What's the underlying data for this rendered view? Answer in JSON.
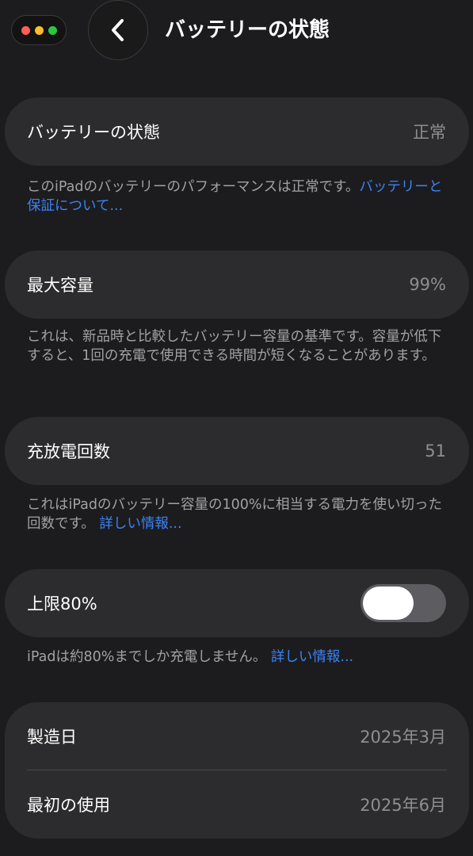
{
  "header": {
    "title": "バッテリーの状態",
    "window_dots": [
      "#ff5f57",
      "#febc2e",
      "#28c840"
    ]
  },
  "battery_health": {
    "label": "バッテリーの状態",
    "value": "正常",
    "footnote_text": "このiPadのバッテリーのパフォーマンスは正常です。",
    "footnote_link": "バッテリーと保証について..."
  },
  "max_capacity": {
    "label": "最大容量",
    "value": "99%",
    "footnote_text": "これは、新品時と比較したバッテリー容量の基準です。容量が低下すると、1回の充電で使用できる時間が短くなることがあります。"
  },
  "cycle_count": {
    "label": "充放電回数",
    "value": "51",
    "footnote_text": "これはiPadのバッテリー容量の100%に相当する電力を使い切った回数です。",
    "footnote_link": "詳しい情報..."
  },
  "limit": {
    "label": "上限80%",
    "toggle_on": false,
    "footnote_text": "iPadは約80%までしか充電しません。",
    "footnote_link": "詳しい情報..."
  },
  "dates": {
    "manufacture_label": "製造日",
    "manufacture_value": "2025年3月",
    "first_use_label": "最初の使用",
    "first_use_value": "2025年6月"
  },
  "colors": {
    "background": "#1c1c1e",
    "card": "#2c2c2e",
    "link": "#3b82f6",
    "secondary_text": "#8e8e93"
  }
}
